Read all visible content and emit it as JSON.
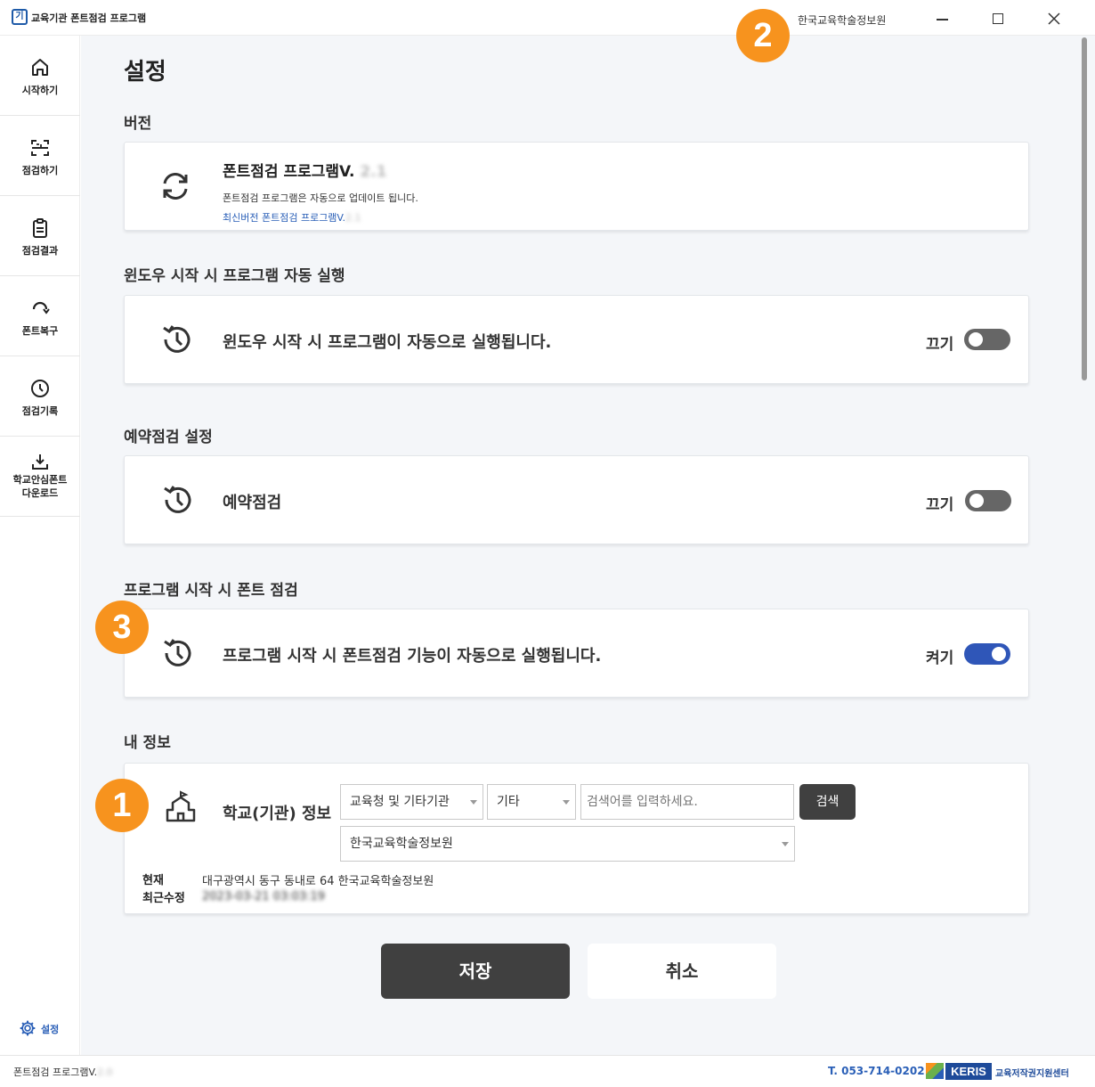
{
  "titlebar": {
    "logo_text": "기",
    "app_title": "교육기관 폰트점검 프로그램",
    "org_name": "한국교육학술정보원"
  },
  "sidebar": {
    "items": [
      {
        "label": "시작하기",
        "icon": "home-icon"
      },
      {
        "label": "점검하기",
        "icon": "scan-icon"
      },
      {
        "label": "점검결과",
        "icon": "clipboard-icon"
      },
      {
        "label": "폰트복구",
        "icon": "restore-icon"
      },
      {
        "label": "점검기록",
        "icon": "clock-icon"
      },
      {
        "label_line1": "학교안심폰트",
        "label_line2": "다운로드",
        "icon": "download-icon"
      }
    ],
    "settings_label": "설정"
  },
  "page": {
    "title": "설정"
  },
  "version_section": {
    "title": "버전",
    "program_name": "폰트점검 프로그램V.",
    "program_version": "2.1",
    "desc": "폰트점검 프로그램은 자동으로 업데이트 됩니다.",
    "latest_label": "최신버전 폰트점검 프로그램V.",
    "latest_version": "2.1"
  },
  "autostart_section": {
    "title": "윈도우 시작 시 프로그램 자동 실행",
    "text": "윈도우 시작 시 프로그램이 자동으로 실행됩니다.",
    "toggle_label": "끄기",
    "toggle_on": false
  },
  "schedule_section": {
    "title": "예약점검 설정",
    "text": "예약점검",
    "toggle_label": "끄기",
    "toggle_on": false
  },
  "startup_check_section": {
    "title": "프로그램 시작 시 폰트 점검",
    "text": "프로그램 시작 시 폰트점검 기능이 자동으로 실행됩니다.",
    "toggle_label": "켜기",
    "toggle_on": true
  },
  "my_info_section": {
    "title": "내 정보",
    "label": "학교(기관) 정보",
    "category_select": "교육청 및 기타기관",
    "type_select": "기타",
    "search_placeholder": "검색어를 입력하세요.",
    "search_button": "검색",
    "institution_select": "한국교육학술정보원",
    "current_label": "현재",
    "current_value": "대구광역시 동구 동내로 64 한국교육학술정보원",
    "modified_label": "최근수정",
    "modified_value": "2023-03-21 03:03:19"
  },
  "buttons": {
    "save": "저장",
    "cancel": "취소"
  },
  "badges": {
    "badge1": "1",
    "badge2": "2",
    "badge3": "3"
  },
  "statusbar": {
    "version_label": "폰트점검 프로그램V.",
    "version_value": "2.0",
    "phone": "T. 053-714-0202",
    "keris": "KERIS",
    "center_name": "교육저작권지원센터"
  },
  "colors": {
    "accent": "#2f56b8",
    "badge": "#f7931e",
    "dark_button": "#404040"
  }
}
